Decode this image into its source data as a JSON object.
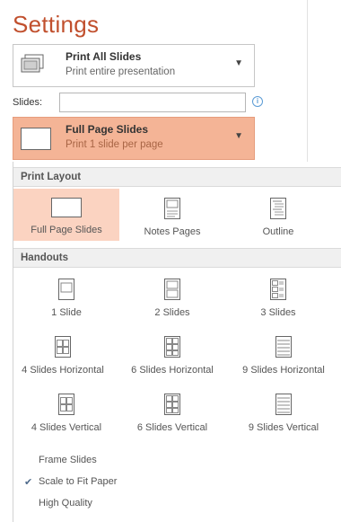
{
  "settings": {
    "title": "Settings"
  },
  "print_range": {
    "title": "Print All Slides",
    "subtitle": "Print entire presentation"
  },
  "slides": {
    "label": "Slides:",
    "value": "",
    "info_icon": "info-icon"
  },
  "layout_dropdown": {
    "title": "Full Page Slides",
    "subtitle": "Print 1 slide per page"
  },
  "print_layout": {
    "header": "Print Layout",
    "options": [
      {
        "label": "Full Page Slides",
        "icon": "full-page-slide-icon",
        "selected": true
      },
      {
        "label": "Notes Pages",
        "icon": "notes-pages-icon",
        "selected": false
      },
      {
        "label": "Outline",
        "icon": "outline-icon",
        "selected": false
      }
    ]
  },
  "handouts": {
    "header": "Handouts",
    "options": [
      {
        "label": "1 Slide",
        "icon": "handout-1-slide-icon"
      },
      {
        "label": "2 Slides",
        "icon": "handout-2-slides-icon"
      },
      {
        "label": "3 Slides",
        "icon": "handout-3-slides-icon"
      },
      {
        "label": "4 Slides Horizontal",
        "icon": "handout-4-horizontal-icon"
      },
      {
        "label": "6 Slides Horizontal",
        "icon": "handout-6-horizontal-icon"
      },
      {
        "label": "9 Slides Horizontal",
        "icon": "handout-9-horizontal-icon"
      },
      {
        "label": "4 Slides Vertical",
        "icon": "handout-4-vertical-icon"
      },
      {
        "label": "6 Slides Vertical",
        "icon": "handout-6-vertical-icon"
      },
      {
        "label": "9 Slides Vertical",
        "icon": "handout-9-vertical-icon"
      }
    ]
  },
  "menu": [
    {
      "label": "Frame Slides",
      "checked": false
    },
    {
      "label": "Scale to Fit Paper",
      "checked": true
    },
    {
      "label": "High Quality",
      "checked": false
    }
  ],
  "colors": {
    "accent": "#c1502e",
    "selected_bg": "#f4b496",
    "hover_bg": "#fbd3c1",
    "check": "#4f6b8c"
  }
}
